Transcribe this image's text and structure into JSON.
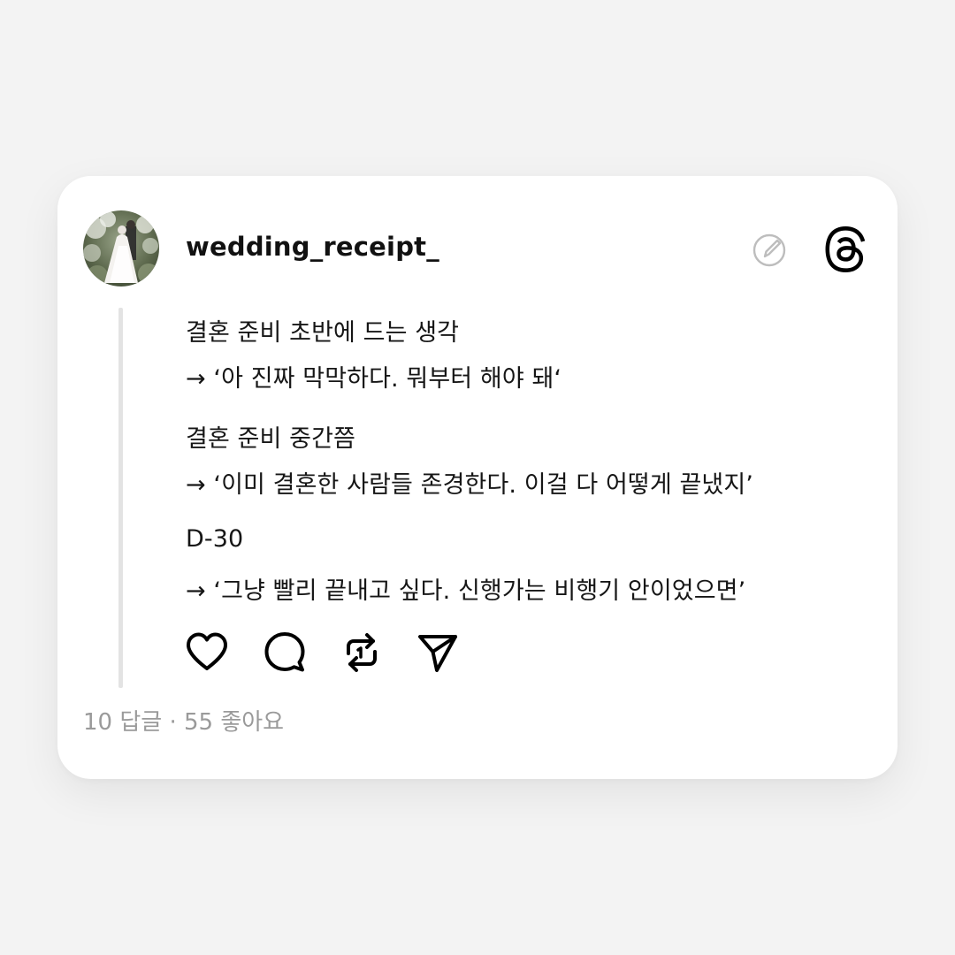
{
  "post": {
    "username": "wedding_receipt_",
    "lines": [
      "결혼 준비 초반에 드는 생각",
      "→ ‘아 진짜 막막하다. 뭐부터 해야 돼‘",
      "결혼 준비 중간쯤",
      "→ ‘이미 결혼한 사람들 존경한다. 이걸 다 어떻게 끝냈지’",
      "D-30",
      "→ ‘그냥 빨리 끝내고 싶다. 신행가는 비행기 안이었으면’"
    ],
    "stats": "10 답글 · 55 좋아요"
  },
  "icons": {
    "avatar": "wedding-photo-avatar",
    "edit": "edit-pencil-icon",
    "logo": "threads-logo-icon",
    "like": "heart-icon",
    "comment": "comment-bubble-icon",
    "repost": "repost-arrows-icon",
    "share": "send-paper-plane-icon"
  },
  "colors": {
    "background": "#f3f3f3",
    "card": "#ffffff",
    "text": "#161616",
    "muted": "#9a9a9a",
    "thread_line": "#e3e3e3",
    "edit_icon": "#bdbdbd"
  }
}
